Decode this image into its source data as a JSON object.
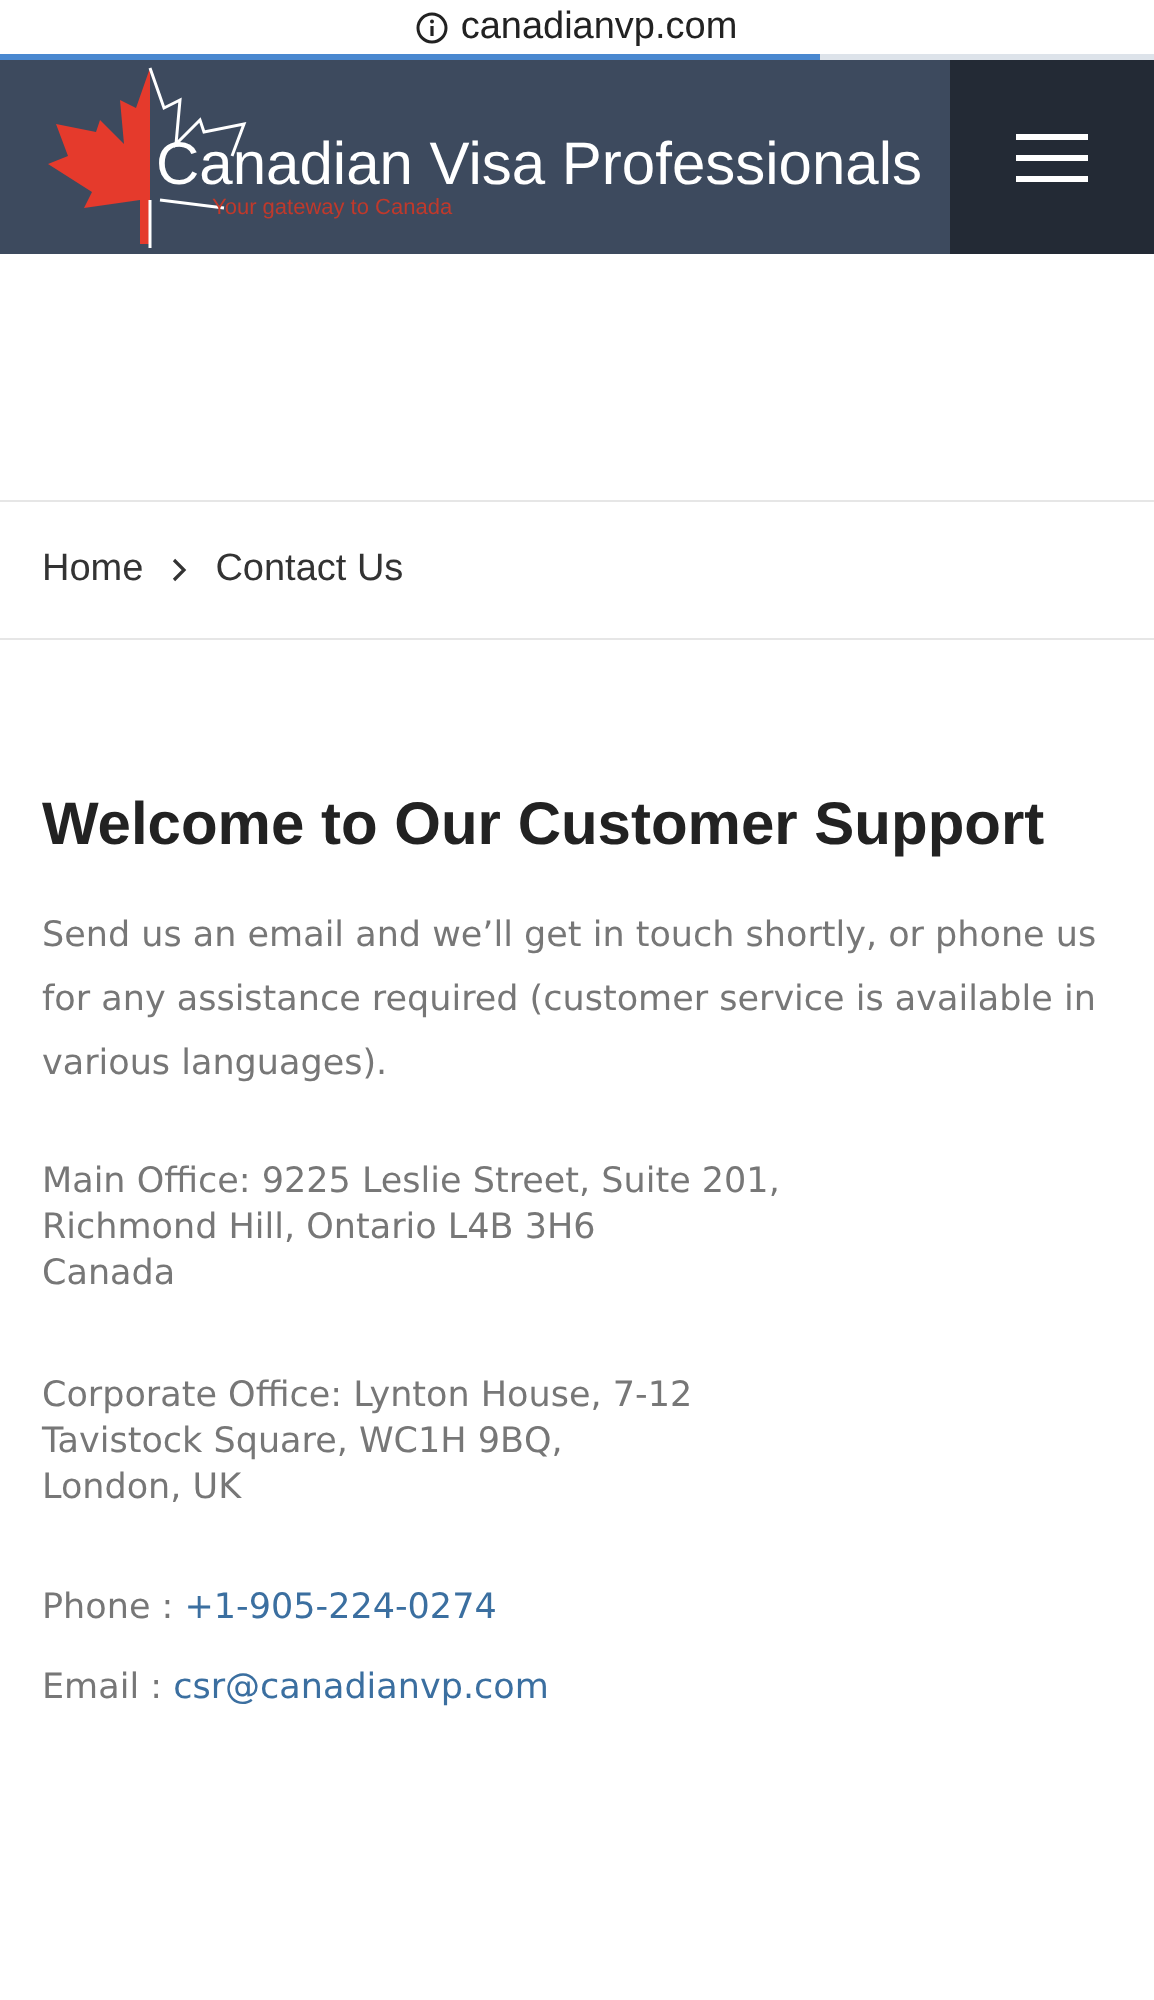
{
  "browser": {
    "url": "canadianvp.com",
    "progress": {
      "level": 0.71
    }
  },
  "header": {
    "brand": "Canadian Visa Professionals",
    "tagline": "Your gateway to Canada"
  },
  "breadcrumb": [
    {
      "label": "Home"
    },
    {
      "label": "Contact Us"
    }
  ],
  "heading": "Welcome to Our Customer Support",
  "intro": "Send us an email and we’ll get in touch shortly, or phone us for any assistance required (customer service is available in various languages).",
  "addresses": [
    {
      "lines": [
        "Main Office: 9225 Leslie Street, Suite 201,",
        "Richmond Hill, Ontario L4B 3H6",
        "Canada"
      ]
    },
    {
      "lines": [
        "Corporate Office: Lynton House, 7-12",
        "Tavistock Square, WC1H 9BQ,",
        "London, UK"
      ]
    }
  ],
  "contacts": [
    {
      "label": "Phone :",
      "value": "+1-905-224-0274"
    },
    {
      "label": "Email :",
      "value": "csr@canadianvp.com"
    }
  ]
}
